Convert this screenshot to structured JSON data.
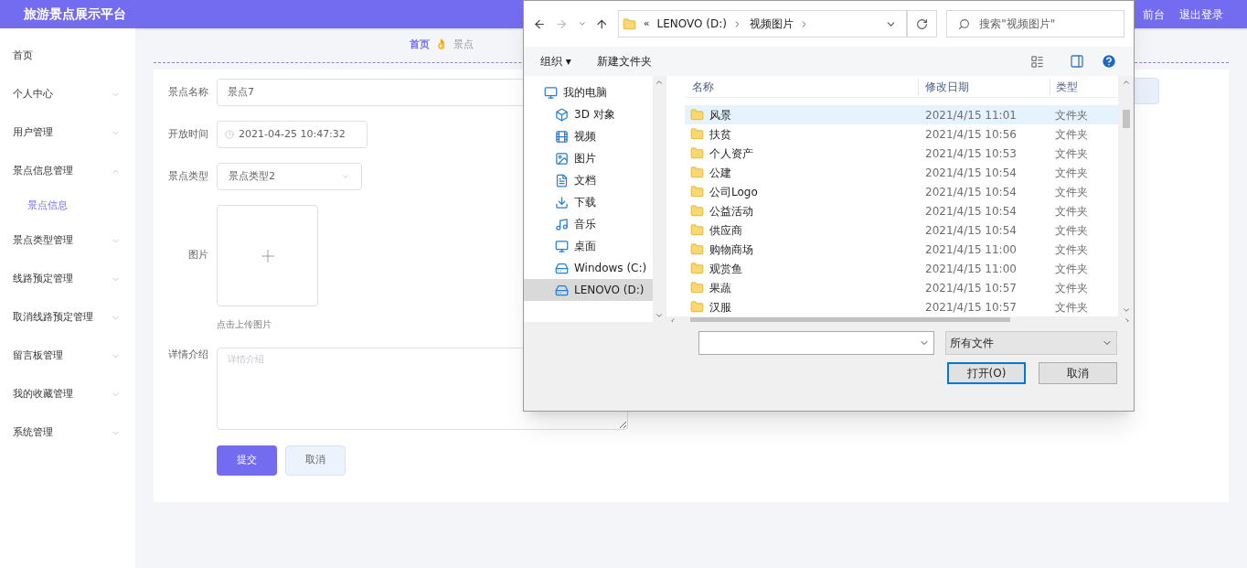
{
  "header": {
    "title": "旅游景点展示平台",
    "links": [
      "前台",
      "退出登录"
    ]
  },
  "sidebar": {
    "items": [
      {
        "label": "首页",
        "expandable": false
      },
      {
        "label": "个人中心",
        "expandable": true,
        "expanded": false
      },
      {
        "label": "用户管理",
        "expandable": true,
        "expanded": false
      },
      {
        "label": "景点信息管理",
        "expandable": true,
        "expanded": true,
        "children": [
          {
            "label": "景点信息",
            "selected": true
          }
        ]
      },
      {
        "label": "景点类型管理",
        "expandable": true,
        "expanded": false
      },
      {
        "label": "线路预定管理",
        "expandable": true,
        "expanded": false
      },
      {
        "label": "取消线路预定管理",
        "expandable": true,
        "expanded": false
      },
      {
        "label": "留言板管理",
        "expandable": true,
        "expanded": false
      },
      {
        "label": "我的收藏管理",
        "expandable": true,
        "expanded": false
      },
      {
        "label": "系统管理",
        "expandable": true,
        "expanded": false
      }
    ]
  },
  "breadcrumb": [
    "首页",
    "👌",
    "景点"
  ],
  "form": {
    "name": {
      "label": "景点名称",
      "value": "景点7"
    },
    "open_time": {
      "label": "开放时间",
      "value": "2021-04-25 10:47:32"
    },
    "type": {
      "label": "景点类型",
      "value": "景点类型2"
    },
    "image": {
      "label": "图片",
      "hint": "点击上传图片"
    },
    "details": {
      "label": "详情介绍",
      "placeholder": "详情介绍"
    },
    "buttons": [
      "提交",
      "取消"
    ]
  },
  "file_dialog": {
    "overflow": "«",
    "path": [
      "LENOVO (D:)",
      "视频图片"
    ],
    "search_placeholder": "搜索\"视频图片\"",
    "toolbar": [
      "组织",
      "新建文件夹"
    ],
    "menu_caret": "▾",
    "nav": [
      {
        "label": "我的电脑",
        "kind": "pc",
        "selected": false
      },
      {
        "label": "3D 对象",
        "kind": "cube",
        "selected": false
      },
      {
        "label": "视频",
        "kind": "film",
        "selected": false
      },
      {
        "label": "图片",
        "kind": "image",
        "selected": false
      },
      {
        "label": "文档",
        "kind": "doc",
        "selected": false
      },
      {
        "label": "下载",
        "kind": "download",
        "selected": false
      },
      {
        "label": "音乐",
        "kind": "music",
        "selected": false
      },
      {
        "label": "桌面",
        "kind": "desktop",
        "selected": false
      },
      {
        "label": "Windows (C:)",
        "kind": "drive",
        "selected": false
      },
      {
        "label": "LENOVO (D:)",
        "kind": "drive",
        "selected": true
      }
    ],
    "columns": [
      "名称",
      "修改日期",
      "类型"
    ],
    "rows": [
      {
        "name": "风景",
        "date": "2021/4/15 11:01",
        "type": "文件夹",
        "selected": true
      },
      {
        "name": "扶贫",
        "date": "2021/4/15 10:56",
        "type": "文件夹",
        "selected": false
      },
      {
        "name": "个人资产",
        "date": "2021/4/15 10:53",
        "type": "文件夹",
        "selected": false
      },
      {
        "name": "公建",
        "date": "2021/4/15 10:54",
        "type": "文件夹",
        "selected": false
      },
      {
        "name": "公司Logo",
        "date": "2021/4/15 10:54",
        "type": "文件夹",
        "selected": false
      },
      {
        "name": "公益活动",
        "date": "2021/4/15 10:54",
        "type": "文件夹",
        "selected": false
      },
      {
        "name": "供应商",
        "date": "2021/4/15 10:54",
        "type": "文件夹",
        "selected": false
      },
      {
        "name": "购物商场",
        "date": "2021/4/15 11:00",
        "type": "文件夹",
        "selected": false
      },
      {
        "name": "观赏鱼",
        "date": "2021/4/15 11:00",
        "type": "文件夹",
        "selected": false
      },
      {
        "name": "果蔬",
        "date": "2021/4/15 10:57",
        "type": "文件夹",
        "selected": false
      },
      {
        "name": "汉服",
        "date": "2021/4/15 10:57",
        "type": "文件夹",
        "selected": false
      }
    ],
    "filter": "所有文件",
    "buttons": [
      "打开(O)",
      "取消"
    ]
  }
}
